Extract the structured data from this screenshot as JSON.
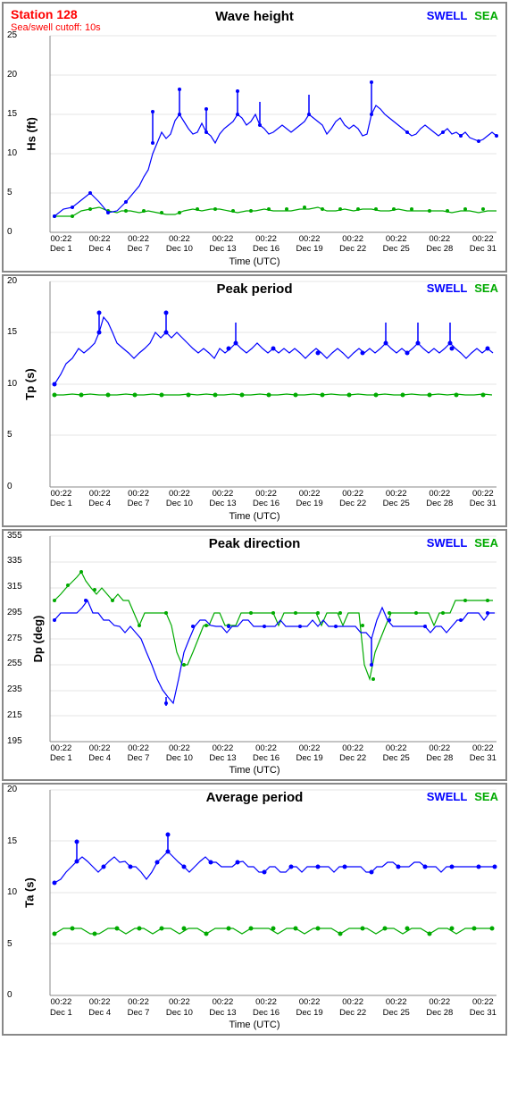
{
  "station": {
    "name": "Station 128",
    "cutoff": "Sea/swell cutoff: 10s"
  },
  "legend": {
    "swell": "SWELL",
    "sea": "SEA"
  },
  "charts": [
    {
      "id": "wave-height",
      "title": "Wave height",
      "y_label": "Hs (ft)",
      "y_ticks": [
        0,
        5,
        10,
        15,
        20,
        25
      ],
      "y_min": 0,
      "y_max": 25
    },
    {
      "id": "peak-period",
      "title": "Peak period",
      "y_label": "Tp (s)",
      "y_ticks": [
        0,
        5,
        10,
        15,
        20
      ],
      "y_min": 0,
      "y_max": 20
    },
    {
      "id": "peak-direction",
      "title": "Peak direction",
      "y_label": "Dp (deg)",
      "y_ticks": [
        195,
        215,
        235,
        255,
        275,
        295,
        315,
        335,
        355
      ],
      "y_min": 195,
      "y_max": 355
    },
    {
      "id": "avg-period",
      "title": "Average period",
      "y_label": "Ta (s)",
      "y_ticks": [
        0,
        5,
        10,
        15,
        20
      ],
      "y_min": 0,
      "y_max": 20
    }
  ],
  "x_labels": [
    {
      "line1": "00:22",
      "line2": "Dec 1"
    },
    {
      "line1": "00:22",
      "line2": "Dec 4"
    },
    {
      "line1": "00:22",
      "line2": "Dec 7"
    },
    {
      "line1": "00:22",
      "line2": "Dec 10"
    },
    {
      "line1": "00:22",
      "line2": "Dec 13"
    },
    {
      "line1": "00:22",
      "line2": "Dec 16"
    },
    {
      "line1": "00:22",
      "line2": "Dec 19"
    },
    {
      "line1": "00:22",
      "line2": "Dec 22"
    },
    {
      "line1": "00:22",
      "line2": "Dec 25"
    },
    {
      "line1": "00:22",
      "line2": "Dec 28"
    },
    {
      "line1": "00:22",
      "line2": "Dec 31"
    }
  ],
  "x_axis_title": "Time (UTC)"
}
